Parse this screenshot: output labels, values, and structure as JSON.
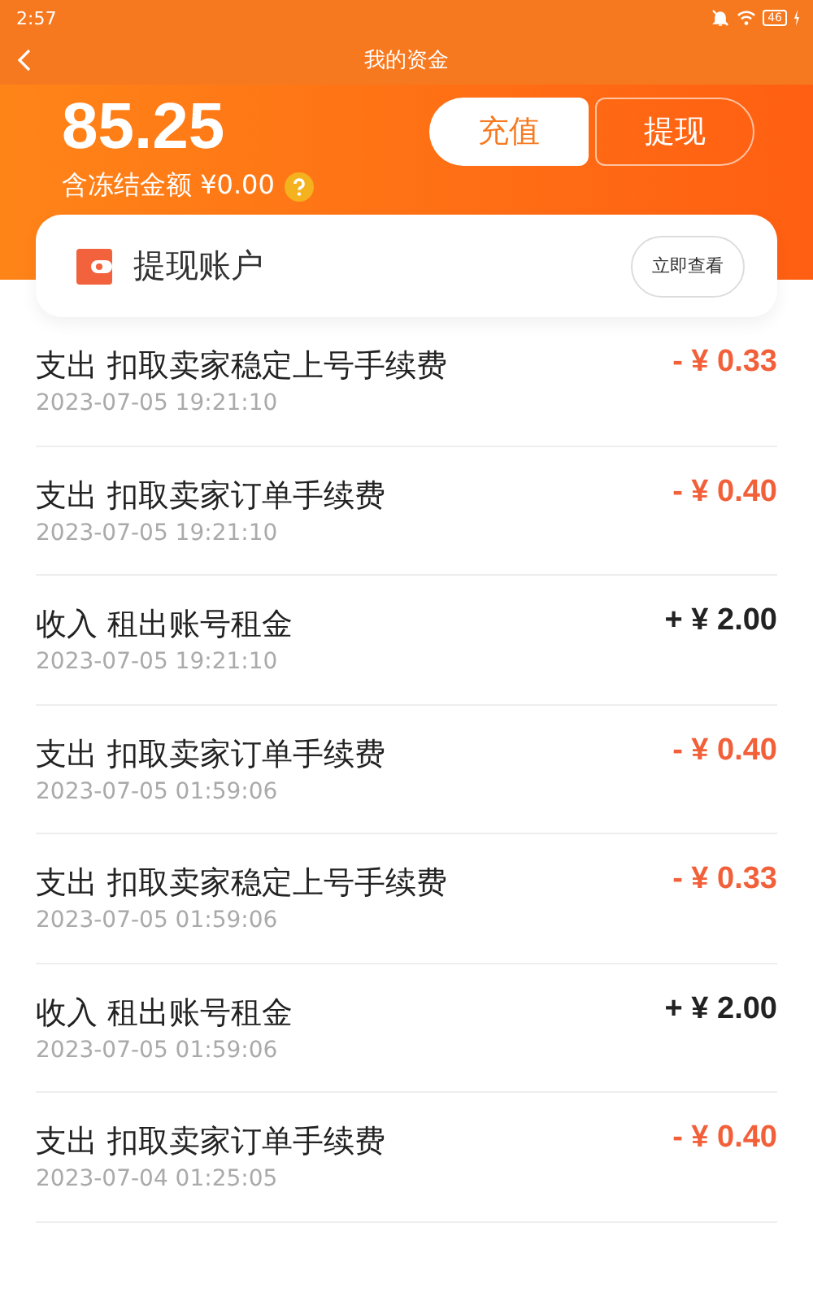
{
  "status_bar": {
    "time": "2:57",
    "battery": "46"
  },
  "nav": {
    "title": "我的资金"
  },
  "balance": {
    "amount": "85.25",
    "frozen_label": "含冻结金额",
    "frozen_amount": "¥0.00"
  },
  "actions": [
    {
      "label": "充值",
      "kind": "primary"
    },
    {
      "label": "提现",
      "kind": "outline"
    }
  ],
  "account_card": {
    "title": "提现账户",
    "button": "立即查看"
  },
  "transactions": [
    {
      "kind": "expense",
      "type": "支出",
      "title": "扣取卖家稳定上号手续费",
      "time": "2023-07-05 19:21:10",
      "amount": "- ¥ 0.33"
    },
    {
      "kind": "expense",
      "type": "支出",
      "title": "扣取卖家订单手续费",
      "time": "2023-07-05 19:21:10",
      "amount": "- ¥ 0.40"
    },
    {
      "kind": "income",
      "type": "收入",
      "title": "租出账号租金",
      "time": "2023-07-05 19:21:10",
      "amount": "+ ¥ 2.00"
    },
    {
      "kind": "expense",
      "type": "支出",
      "title": "扣取卖家订单手续费",
      "time": "2023-07-05 01:59:06",
      "amount": "- ¥ 0.40"
    },
    {
      "kind": "expense",
      "type": "支出",
      "title": "扣取卖家稳定上号手续费",
      "time": "2023-07-05 01:59:06",
      "amount": "- ¥ 0.33"
    },
    {
      "kind": "income",
      "type": "收入",
      "title": "租出账号租金",
      "time": "2023-07-05 01:59:06",
      "amount": "+ ¥ 2.00"
    },
    {
      "kind": "expense",
      "type": "支出",
      "title": "扣取卖家订单手续费",
      "time": "2023-07-04 01:25:05",
      "amount": "- ¥ 0.40"
    }
  ]
}
